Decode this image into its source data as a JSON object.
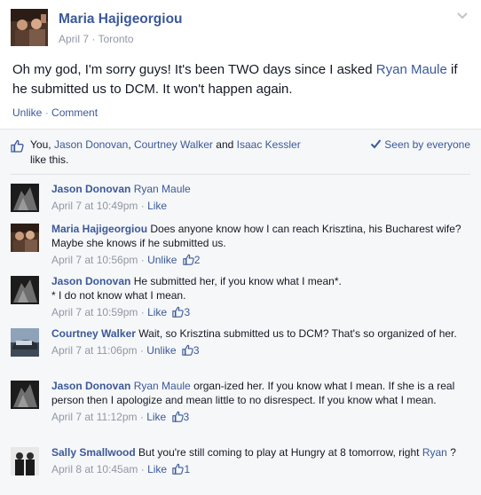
{
  "post": {
    "author": "Maria Hajigeorgiou",
    "date": "April 7",
    "separator": "·",
    "location": "Toronto",
    "text_before": "Oh my god, I'm sorry guys! It's been TWO days since I asked ",
    "text_mention": "Ryan Maule",
    "text_after": " if he submitted us to DCM. It won't happen again.",
    "action_unlike": "Unlike",
    "action_comment": "Comment"
  },
  "likes": {
    "you": "You,",
    "name1": "Jason Donovan",
    "comma": ",",
    "name2": "Courtney Walker",
    "and": "and",
    "name3": "Isaac Kessler",
    "suffix": "like this.",
    "seen_label": "Seen by everyone"
  },
  "comments": [
    {
      "author": "Jason Donovan",
      "mention": "Ryan Maule",
      "text": "",
      "timestamp": "April 7 at 10:49pm",
      "action": "Like",
      "like_count": ""
    },
    {
      "author": "Maria Hajigeorgiou",
      "mention": "",
      "text": "Does anyone know how I can reach Krisztina, his Bucharest wife? Maybe she knows if he submitted us.",
      "timestamp": "April 7 at 10:56pm",
      "action": "Unlike",
      "like_count": "2"
    },
    {
      "author": "Jason Donovan",
      "mention": "",
      "text": "He submitted her, if you know what I mean*.",
      "text_line2": "* I do not know what I mean.",
      "timestamp": "April 7 at 10:59pm",
      "action": "Like",
      "like_count": "3"
    },
    {
      "author": "Courtney Walker",
      "mention": "",
      "text": "Wait, so Krisztina submitted us to DCM? That's so organized of her.",
      "timestamp": "April 7 at 11:06pm",
      "action": "Unlike",
      "like_count": "3"
    },
    {
      "author": "Jason Donovan",
      "mention": "Ryan Maule",
      "text": "organ-ized her. If you know what I mean. If she is a real person then I apologize and mean little to no disrespect. If you know what I mean.",
      "timestamp": "April 7 at 11:12pm",
      "action": "Like",
      "like_count": "3"
    },
    {
      "author": "Sally Smallwood",
      "mention": "",
      "text": "But you're still coming to play at Hungry at 8 tomorrow, right",
      "mention_end": "Ryan",
      "text_end": "?",
      "timestamp": "April 8 at 10:45am",
      "action": "Like",
      "like_count": "1"
    }
  ],
  "meta_separator": "·",
  "colors": {
    "link": "#3b5998",
    "meta": "#9197a3",
    "text": "#141823",
    "ufi_background": "#f6f7f9"
  },
  "icons": [
    "chevron-down-icon",
    "thumbs-up-icon",
    "checkmark-icon",
    "profile-photo"
  ]
}
